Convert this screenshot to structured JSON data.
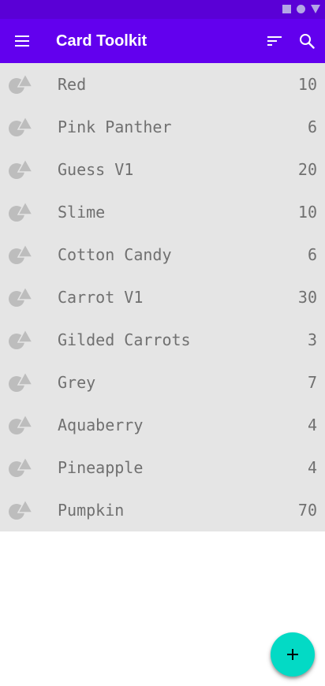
{
  "status_bar": {
    "icons": [
      "square-icon",
      "circle-icon",
      "triangle-icon"
    ]
  },
  "app_bar": {
    "title": "Card Toolkit",
    "menu_icon": "hamburger-menu-icon",
    "sort_icon": "sort-icon",
    "search_icon": "search-icon"
  },
  "list": {
    "items": [
      {
        "name": "Red",
        "count": "10"
      },
      {
        "name": "Pink Panther",
        "count": "6"
      },
      {
        "name": "Guess V1",
        "count": "20"
      },
      {
        "name": "Slime",
        "count": "10"
      },
      {
        "name": "Cotton Candy",
        "count": "6"
      },
      {
        "name": "Carrot V1",
        "count": "30"
      },
      {
        "name": "Gilded Carrots",
        "count": "3"
      },
      {
        "name": "Grey",
        "count": "7"
      },
      {
        "name": "Aquaberry",
        "count": "4"
      },
      {
        "name": "Pineapple",
        "count": "4"
      },
      {
        "name": "Pumpkin",
        "count": "70"
      }
    ],
    "item_icon": "shapes-icon"
  },
  "fab": {
    "icon": "add-icon"
  },
  "colors": {
    "status_bar": "#5a00d6",
    "app_bar": "#6200ee",
    "list_background": "#e5e5e5",
    "list_text": "#707070",
    "fab": "#03dac5"
  }
}
